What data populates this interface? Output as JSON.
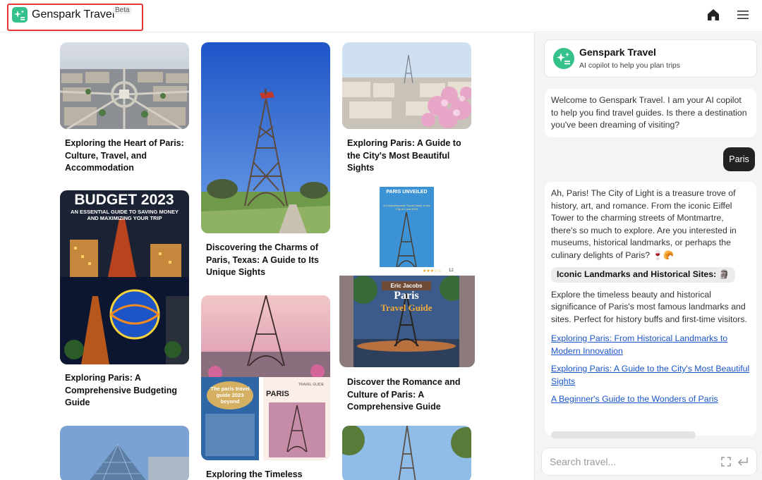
{
  "header": {
    "brand": "Genspark Travel",
    "beta": "Beta",
    "home_icon": "home-icon",
    "menu_icon": "hamburger-menu-icon"
  },
  "feed": {
    "cards": [
      {
        "title": "Exploring the Heart of Paris: Culture, Travel, and Accommodation"
      },
      {
        "title": "Discovering the Charms of Paris, Texas: A Guide to Its Unique Sights"
      },
      {
        "title": "Exploring Paris: A Guide to the City's Most Beautiful Sights"
      },
      {
        "title": "Exploring Paris: A Comprehensive Budgeting Guide",
        "cover_heading": "BUDGET 2023",
        "cover_sub": "AN ESSENTIAL GUIDE TO SAVING MONEY AND MAXIMIZING YOUR TRIP"
      },
      {
        "title": "Discover the Romance and Culture of Paris: A Comprehensive Guide",
        "book_title": "PARIS UNVEILED",
        "book_sub": "A Comprehensive Travel Guide to the City of Love 2023",
        "rating_count": "12",
        "cover_author": "Eric Jacobs",
        "cover_title": "Paris",
        "cover_sub": "Travel Guide"
      },
      {
        "title": "Exploring the Timeless",
        "book_a": "The paris travel guide 2023 beyond",
        "book_b": "PARIS",
        "book_c": "TRAVEL GUIDE"
      }
    ]
  },
  "chat": {
    "title": "Genspark Travel",
    "subtitle": "AI copilot to help you plan trips",
    "welcome": "Welcome to Genspark Travel. I am your AI copilot to help you find travel guides. Is there a destination you've been dreaming of visiting?",
    "user_message": "Paris",
    "reply": "Ah, Paris! The City of Light is a treasure trove of history, art, and romance. From the iconic Eiffel Tower to the charming streets of Montmartre, there's so much to explore. Are you interested in museums, historical landmarks, or perhaps the culinary delights of Paris? 🍷🥐",
    "section_title": "Iconic Landmarks and Historical Sites: 🗿",
    "section_text": "Explore the timeless beauty and historical significance of Paris's most famous landmarks and sites. Perfect for history buffs and first-time visitors.",
    "links": [
      "Exploring Paris: From Historical Landmarks to Modern Innovation",
      "Exploring Paris: A Guide to the City's Most Beautiful Sights",
      "A Beginner's Guide to the Wonders of Paris"
    ],
    "search_placeholder": "Search travel..."
  },
  "colors": {
    "brand_green": "#34c18a",
    "annotation_red": "#e53935",
    "link_blue": "#1a56c9"
  }
}
